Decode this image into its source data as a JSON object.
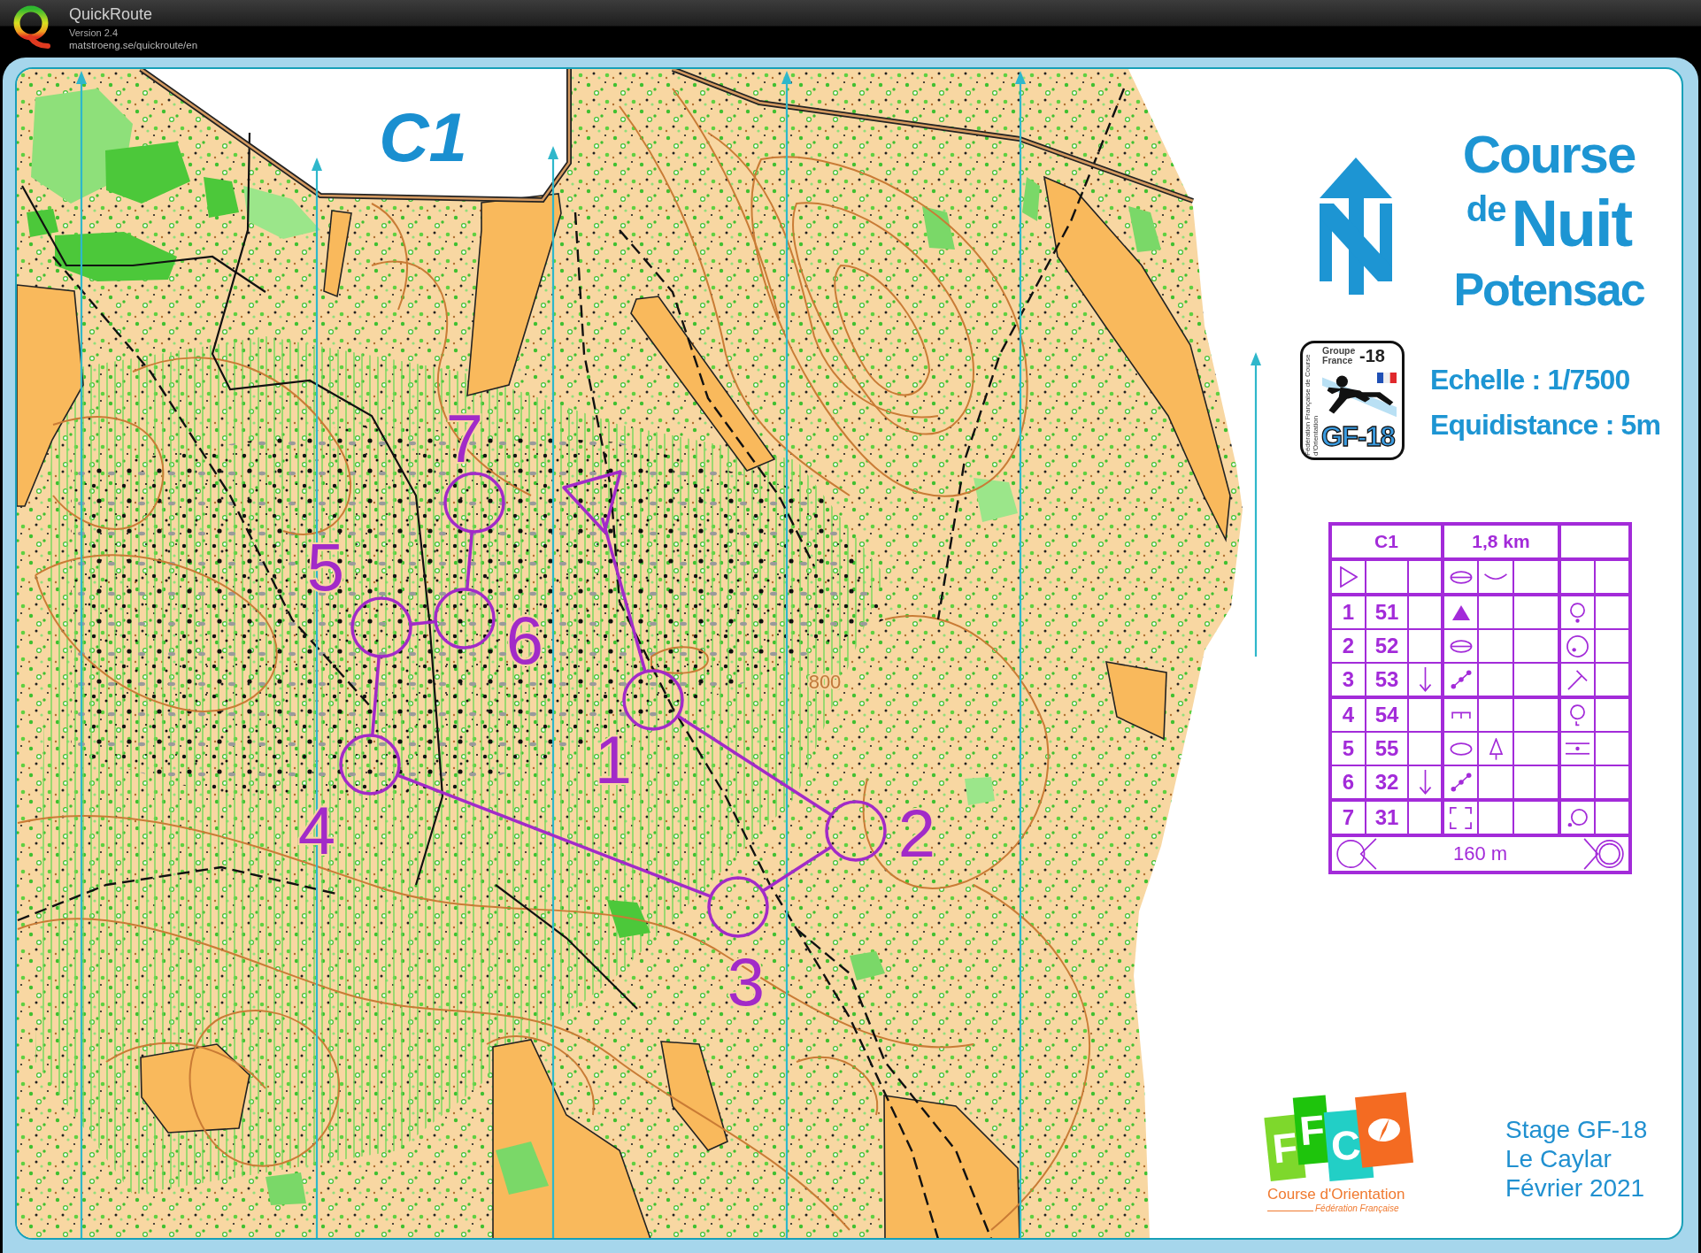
{
  "app": {
    "name": "QuickRoute",
    "version": "Version 2.4",
    "website": "matstroeng.se/quickroute/en"
  },
  "map": {
    "course_label": "C1",
    "contour_label": "800",
    "controls": [
      {
        "number": "1"
      },
      {
        "number": "2"
      },
      {
        "number": "3"
      },
      {
        "number": "4"
      },
      {
        "number": "5"
      },
      {
        "number": "6"
      },
      {
        "number": "7"
      }
    ]
  },
  "legend": {
    "title": [
      "Course",
      "de",
      "Nuit",
      "Potensac"
    ],
    "club_logo": {
      "line_1": "Groupe",
      "line_2": "France",
      "suffix": "-18",
      "badge": "GF-18",
      "side_text": "Fédération Française de Course d'Orientation"
    },
    "scale": "Echelle : 1/7500",
    "contour_interval": "Equidistance : 5m"
  },
  "control_description": {
    "course": "C1",
    "length": "1,8 km",
    "start": {
      "feature": {
        "kind": "ellipse-bar"
      },
      "appearance": {
        "kind": "arc"
      }
    },
    "rows": [
      {
        "number": "1",
        "code": "51",
        "feature": {
          "kind": "filled-triangle"
        },
        "location": {
          "kind": "circle-dot-below"
        }
      },
      {
        "number": "2",
        "code": "52",
        "feature": {
          "kind": "ellipse-bar"
        },
        "location": {
          "kind": "circle-dot-inside"
        }
      },
      {
        "number": "3",
        "code": "53",
        "which": {
          "kind": "down-arrow"
        },
        "feature": {
          "kind": "dotted-line"
        },
        "location": {
          "kind": "diagonal-t"
        }
      },
      {
        "number": "4",
        "code": "54",
        "feature": {
          "kind": "comb"
        },
        "location": {
          "kind": "circle-tick"
        }
      },
      {
        "number": "5",
        "code": "55",
        "feature": {
          "kind": "ellipse"
        },
        "appearance": {
          "kind": "tree"
        },
        "location": {
          "kind": "dot-between-lines"
        }
      },
      {
        "number": "6",
        "code": "32",
        "which": {
          "kind": "down-arrow"
        },
        "feature": {
          "kind": "dotted-line"
        }
      },
      {
        "number": "7",
        "code": "31",
        "feature": {
          "kind": "corner-brackets"
        },
        "location": {
          "kind": "circle-dot-left"
        }
      }
    ],
    "finish": {
      "distance": "160 m"
    }
  },
  "footer": {
    "federation_logo": {
      "letters": [
        "F",
        "F",
        "C"
      ],
      "name": "Course d'Orientation",
      "subtitle": "Fédération Française"
    },
    "event": [
      "Stage GF-18",
      "Le Caylar",
      "Février 2021"
    ]
  }
}
